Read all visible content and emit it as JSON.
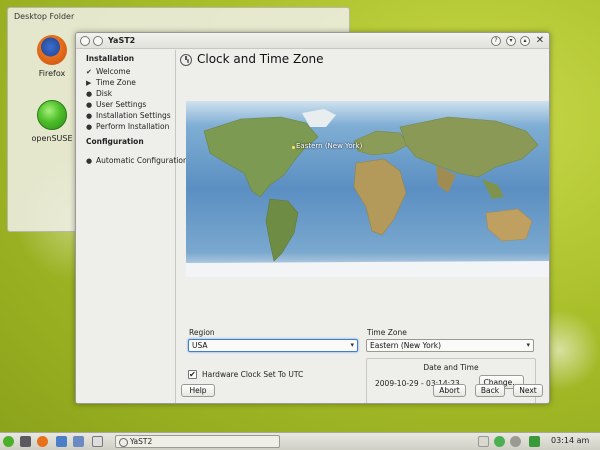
{
  "desktop": {
    "folder_title": "Desktop Folder",
    "icons": [
      {
        "label": "Firefox"
      },
      {
        "label": "openSUSE"
      }
    ]
  },
  "window": {
    "title": "YaST2",
    "titlebar_icons": [
      "menu-icon",
      "pin-icon",
      "help-icon",
      "minimize-icon",
      "maximize-icon",
      "close-icon"
    ]
  },
  "sidebar": {
    "sections": [
      {
        "title": "Installation",
        "steps": [
          {
            "label": "Welcome",
            "state": "done",
            "mark": "✔"
          },
          {
            "label": "Time Zone",
            "state": "current",
            "mark": "▶"
          },
          {
            "label": "Disk",
            "state": "pending",
            "mark": "●"
          },
          {
            "label": "User Settings",
            "state": "pending",
            "mark": "●"
          },
          {
            "label": "Installation Settings",
            "state": "pending",
            "mark": "●"
          },
          {
            "label": "Perform Installation",
            "state": "pending",
            "mark": "●"
          }
        ]
      },
      {
        "title": "Configuration",
        "steps": [
          {
            "label": "Automatic Configuration",
            "state": "pending",
            "mark": "●"
          }
        ]
      }
    ]
  },
  "main": {
    "page_title": "Clock and Time Zone",
    "map": {
      "selected_label": "Eastern (New York)"
    },
    "region": {
      "label": "Region",
      "value": "USA"
    },
    "timezone": {
      "label": "Time Zone",
      "value": "Eastern (New York)"
    },
    "hardware_clock": {
      "label": "Hardware Clock Set To UTC",
      "checked": true,
      "check_glyph": "✔"
    },
    "date_time": {
      "title": "Date and Time",
      "value": "2009-10-29 - 03:14:23",
      "change_label": "Change..."
    }
  },
  "buttons": {
    "help": "Help",
    "abort": "Abort",
    "back": "Back",
    "next": "Next"
  },
  "taskbar": {
    "task_label": "YaST2",
    "clock": "03:14 am"
  },
  "colors": {
    "accent": "#3f7fcf",
    "desktop": "#a9bf2a"
  }
}
